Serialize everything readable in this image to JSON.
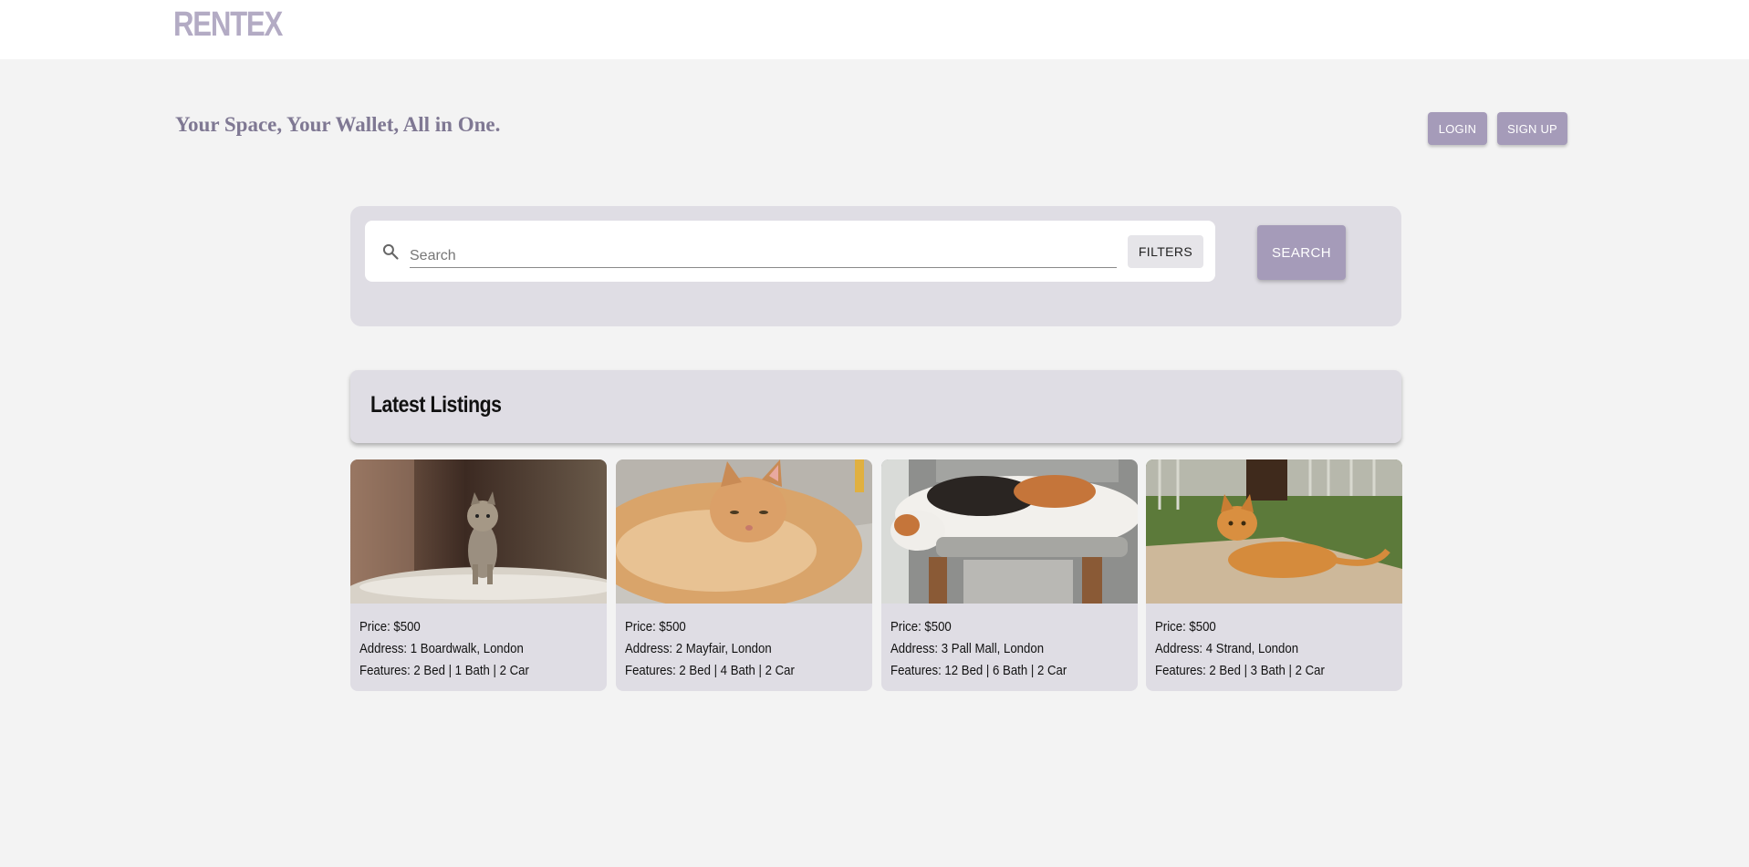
{
  "brand": {
    "logo": "RENTEX",
    "accent_color": "#a59bb9"
  },
  "hero": {
    "tagline": "Your Space, Your Wallet, All in One.",
    "login_label": "LOGIN",
    "signup_label": "SIGN UP"
  },
  "search": {
    "placeholder": "Search",
    "value": "",
    "filters_label": "FILTERS",
    "search_label": "SEARCH",
    "icon": "search-icon"
  },
  "listings": {
    "title": "Latest Listings",
    "items": [
      {
        "image": "tabby-kitten-photo",
        "price": "Price: $500",
        "address": "Address: 1 Boardwalk, London",
        "features": "Features: 2 Bed | 1 Bath | 2 Car"
      },
      {
        "image": "ginger-cat-lying-photo",
        "price": "Price: $500",
        "address": "Address: 2 Mayfair, London",
        "features": "Features: 2 Bed | 4 Bath | 2 Car"
      },
      {
        "image": "calico-cat-on-scratcher-photo",
        "price": "Price: $500",
        "address": "Address: 3 Pall Mall, London",
        "features": "Features: 12 Bed | 6 Bath | 2 Car"
      },
      {
        "image": "orange-cat-outdoors-photo",
        "price": "Price: $500",
        "address": "Address: 4 Strand, London",
        "features": "Features: 2 Bed | 3 Bath | 2 Car"
      }
    ]
  }
}
